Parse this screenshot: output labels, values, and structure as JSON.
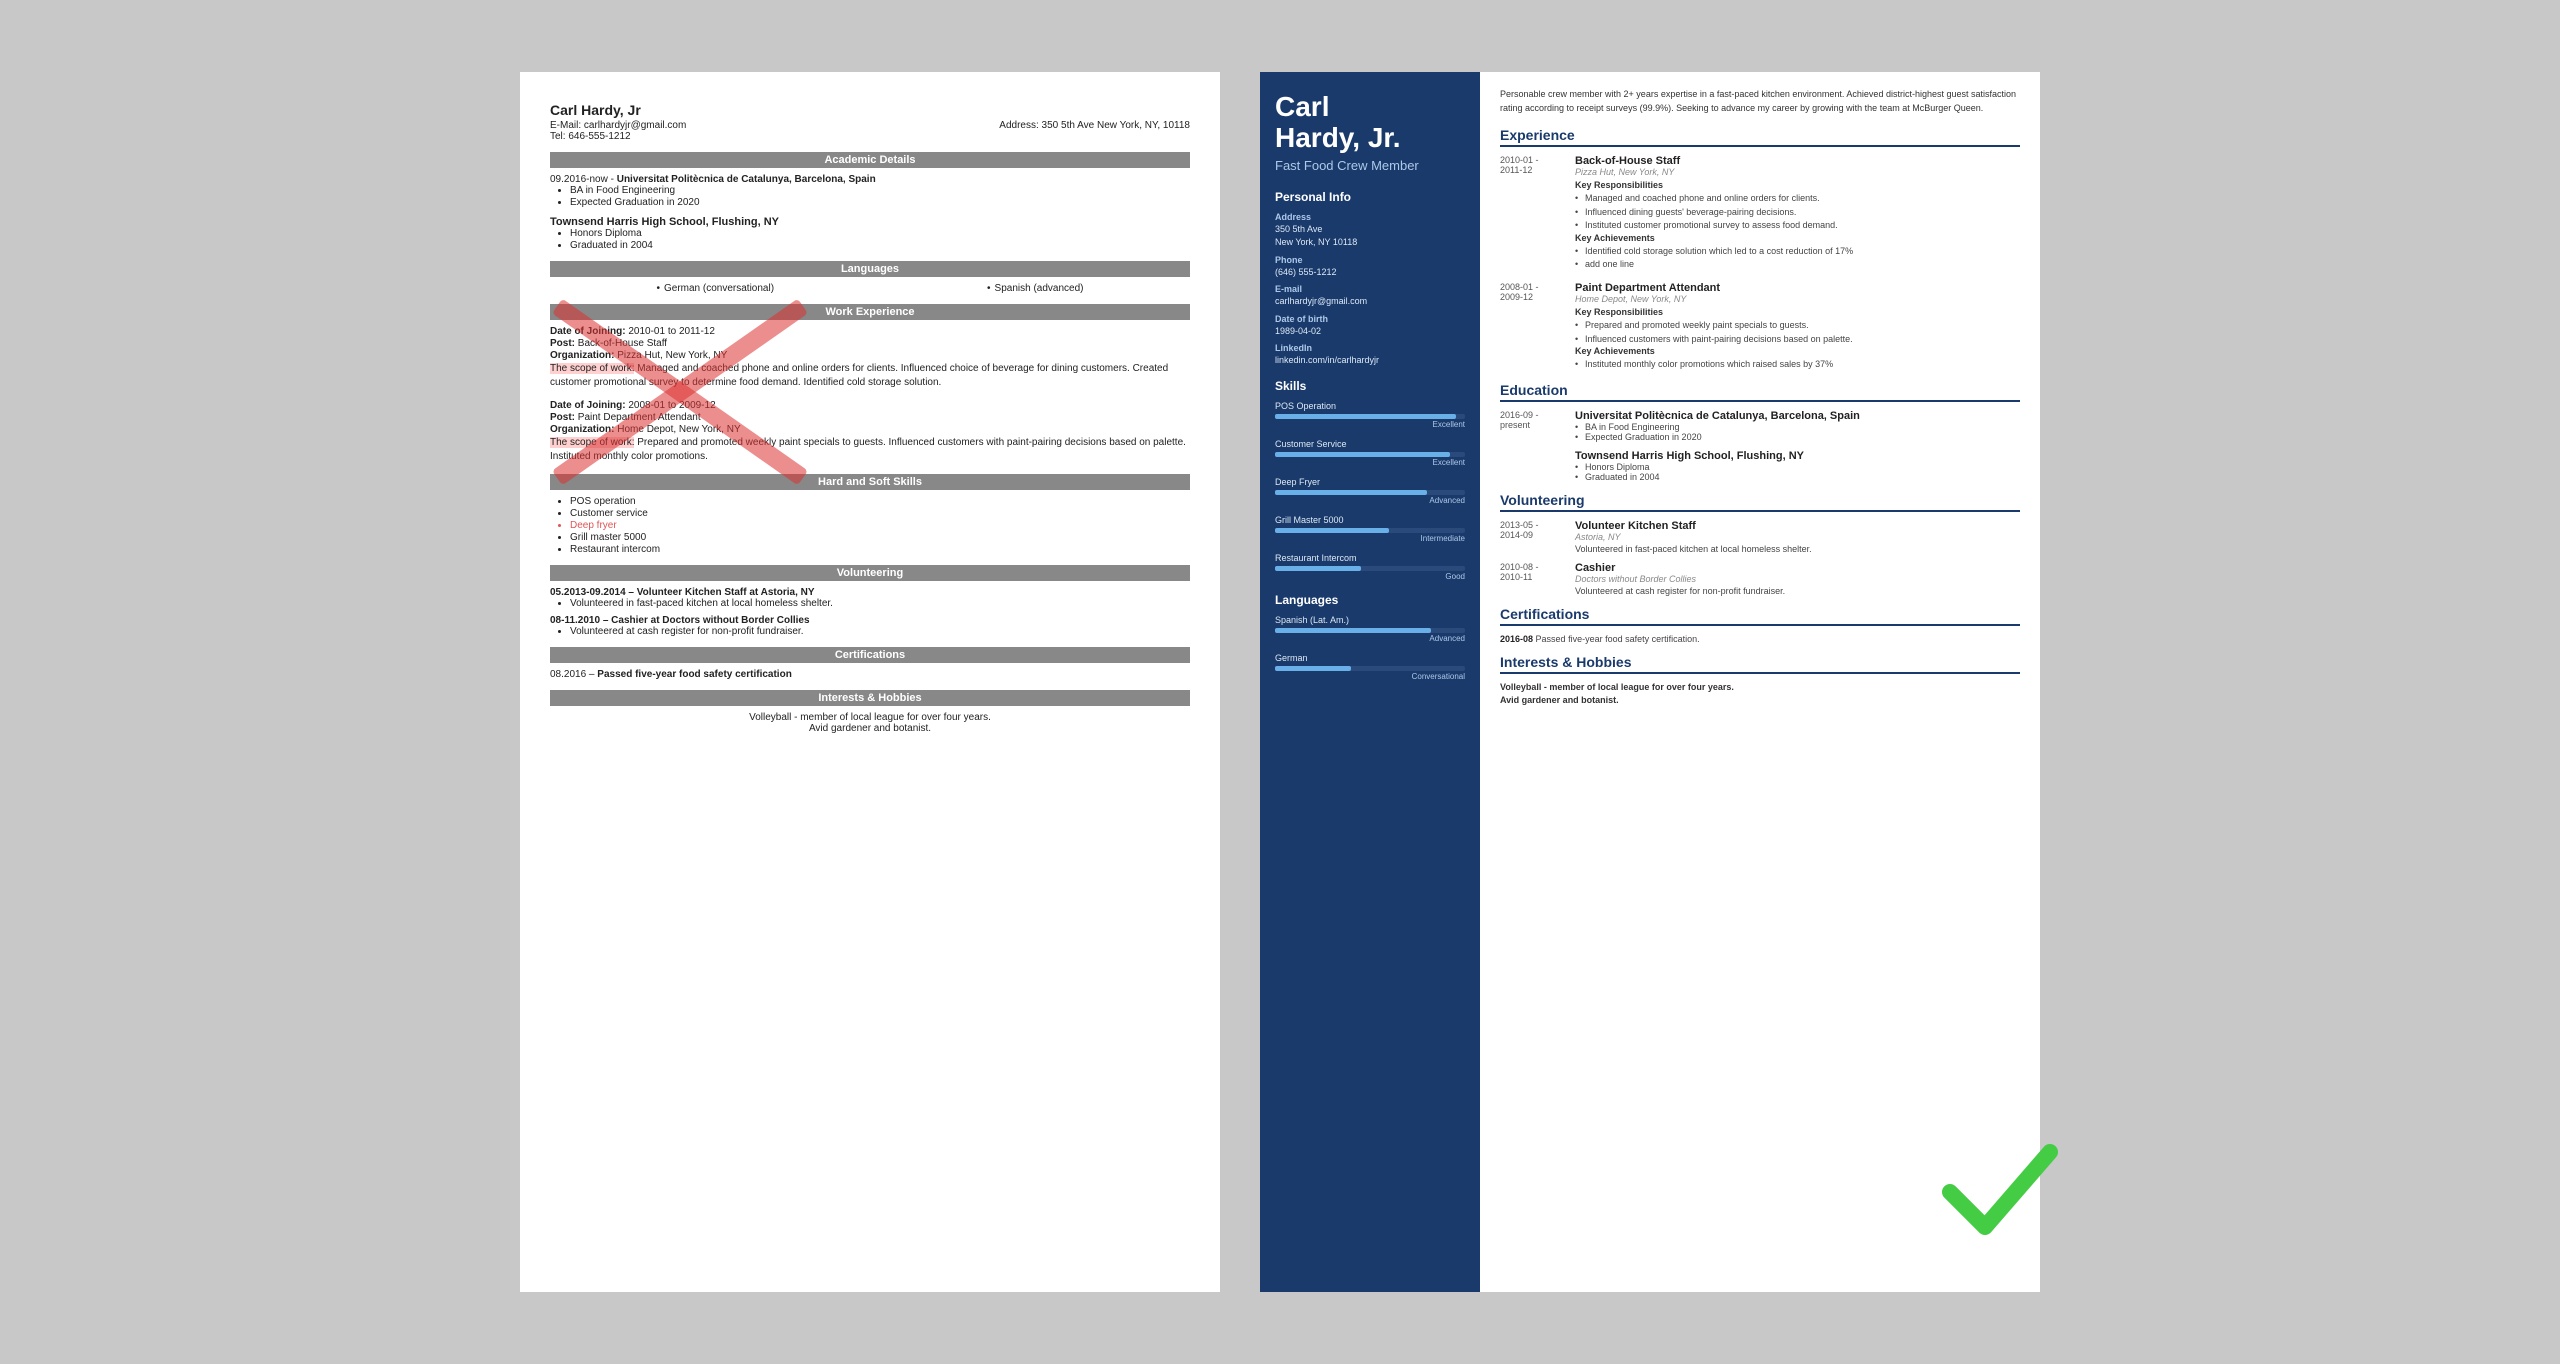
{
  "left_resume": {
    "name": "Carl Hardy, Jr",
    "email_label": "E-Mail:",
    "email": "carlhardyjr@gmail.com",
    "address_label": "Address:",
    "address": "350 5th Ave New York, NY, 10118",
    "tel_label": "Tel:",
    "tel": "646-555-1212",
    "sections": {
      "academic": "Academic Details",
      "languages": "Languages",
      "work": "Work Experience",
      "skills": "Hard and Soft Skills",
      "volunteering": "Volunteering",
      "certifications": "Certifications",
      "interests": "Interests & Hobbies"
    },
    "education": [
      {
        "date": "09.2016-now",
        "school": "Universitat Politècnica de Catalunya, Barcelona, Spain",
        "bullets": [
          "BA in Food Engineering",
          "Expected Graduation in 2020"
        ]
      },
      {
        "date": "",
        "school": "Townsend Harris High School, Flushing, NY",
        "bullets": [
          "Honors Diploma",
          "Graduated in 2004"
        ]
      }
    ],
    "languages": [
      {
        "lang": "German (conversational)"
      },
      {
        "lang": "Spanish (advanced)"
      }
    ],
    "work": [
      {
        "date_label": "Date of Joining:",
        "date": "2010-01 to 2011-12",
        "post_label": "Post:",
        "post": "Back-of-House Staff",
        "org_label": "Organization:",
        "org": "Pizza Hut, New York, NY",
        "scope_label": "The scope of work:",
        "scope": "Managed and coached phone and online orders for clients. Influenced choice of beverage for dining customers. Created customer promotional survey to determine food demand. Identified cold storage solution."
      },
      {
        "date_label": "Date of Joining:",
        "date": "2008-01 to 2009-12",
        "post_label": "Post:",
        "post": "Paint Department Attendant",
        "org_label": "Organization:",
        "org": "Home Depot, New York, NY",
        "scope_label": "The scope of work:",
        "scope": "Prepared and promoted weekly paint specials to guests. Influenced customers with paint-pairing decisions based on palette. Instituted monthly color promotions."
      }
    ],
    "skills": [
      {
        "name": "POS operation",
        "highlight": false
      },
      {
        "name": "Customer service",
        "highlight": false
      },
      {
        "name": "Deep fryer",
        "highlight": true
      },
      {
        "name": "Grill master 5000",
        "highlight": false
      },
      {
        "name": "Restaurant intercom",
        "highlight": false
      }
    ],
    "volunteering": [
      {
        "date": "05.2013-09.2014",
        "title": "Volunteer Kitchen Staff at Astoria, NY",
        "bullets": [
          "Volunteered in fast-paced kitchen at local homeless shelter."
        ]
      },
      {
        "date": "08-11.2010",
        "title": "Cashier at Doctors without Border Collies",
        "bullets": [
          "Volunteered at cash register for non-profit fundraiser."
        ]
      }
    ],
    "certifications": [
      {
        "date": "08.2016",
        "text": "Passed five-year food safety certification"
      }
    ],
    "interests": [
      "Volleyball - member of local league for over four years.",
      "Avid gardener and botanist."
    ]
  },
  "right_resume": {
    "name_line1": "Carl",
    "name_line2": "Hardy, Jr.",
    "title": "Fast Food Crew Member",
    "summary": "Personable crew member with 2+ years expertise in a fast-paced kitchen environment. Achieved district-highest guest satisfaction rating according to receipt surveys (99.9%). Seeking to advance my career by growing with the team at McBurger Queen.",
    "personal_info": {
      "section_title": "Personal Info",
      "address_label": "Address",
      "address": "350 5th Ave\nNew York, NY 10118",
      "phone_label": "Phone",
      "phone": "(646) 555-1212",
      "email_label": "E-mail",
      "email": "carlhardyjr@gmail.com",
      "dob_label": "Date of birth",
      "dob": "1989-04-02",
      "linkedin_label": "LinkedIn",
      "linkedin": "linkedin.com/in/carlhardyjr"
    },
    "skills_section": {
      "title": "Skills",
      "items": [
        {
          "name": "POS Operation",
          "level": "Excellent",
          "pct": 95
        },
        {
          "name": "Customer Service",
          "level": "Excellent",
          "pct": 92
        },
        {
          "name": "Deep Fryer",
          "level": "Advanced",
          "pct": 80
        },
        {
          "name": "Grill Master 5000",
          "level": "Intermediate",
          "pct": 60
        },
        {
          "name": "Restaurant Intercom",
          "level": "Good",
          "pct": 45
        }
      ]
    },
    "languages_section": {
      "title": "Languages",
      "items": [
        {
          "name": "Spanish (Lat. Am.)",
          "level": "Advanced",
          "pct": 82
        },
        {
          "name": "German",
          "level": "Conversational",
          "pct": 40
        }
      ]
    },
    "experience": {
      "title": "Experience",
      "items": [
        {
          "dates": "2010-01 -\n2011-12",
          "title": "Back-of-House Staff",
          "org": "Pizza Hut, New York, NY",
          "responsibilities_title": "Key Responsibilities",
          "responsibilities": [
            "Managed and coached phone and online orders for clients.",
            "Influenced dining guests' beverage-pairing decisions.",
            "Instituted customer promotional survey to assess food demand."
          ],
          "achievements_title": "Key Achievements",
          "achievements": [
            "Identified cold storage solution which led to a cost reduction of 17%",
            "add one line"
          ]
        },
        {
          "dates": "2008-01 -\n2009-12",
          "title": "Paint Department Attendant",
          "org": "Home Depot, New York, NY",
          "responsibilities_title": "Key Responsibilities",
          "responsibilities": [
            "Prepared and promoted weekly paint specials to guests.",
            "Influenced customers with paint-pairing decisions based on palette."
          ],
          "achievements_title": "Key Achievements",
          "achievements": [
            "Instituted monthly color promotions which raised sales by 37%"
          ]
        }
      ]
    },
    "education": {
      "title": "Education",
      "items": [
        {
          "dates": "2016-09 -\npresent",
          "school": "Universitat Politècnica de Catalunya, Barcelona, Spain",
          "details": [
            "BA in Food Engineering",
            "Expected Graduation in 2020"
          ]
        },
        {
          "dates": "",
          "school": "Townsend Harris High School, Flushing, NY",
          "details": [
            "Honors Diploma",
            "Graduated in 2004"
          ]
        }
      ]
    },
    "volunteering": {
      "title": "Volunteering",
      "items": [
        {
          "dates": "2013-05 -\n2014-09",
          "title": "Volunteer Kitchen Staff",
          "org": "Astoria, NY",
          "desc": "Volunteered in fast-paced kitchen at local homeless shelter."
        },
        {
          "dates": "2010-08 -\n2010-11",
          "title": "Cashier",
          "org": "Doctors without Border Collies",
          "desc": "Volunteered at cash register for non-profit fundraiser."
        }
      ]
    },
    "certifications": {
      "title": "Certifications",
      "items": [
        {
          "date": "2016-08",
          "text": "Passed five-year food safety certification."
        }
      ]
    },
    "interests": {
      "title": "Interests & Hobbies",
      "items": [
        "Volleyball - member of local league for over four years.",
        "Avid gardener and botanist."
      ]
    }
  }
}
